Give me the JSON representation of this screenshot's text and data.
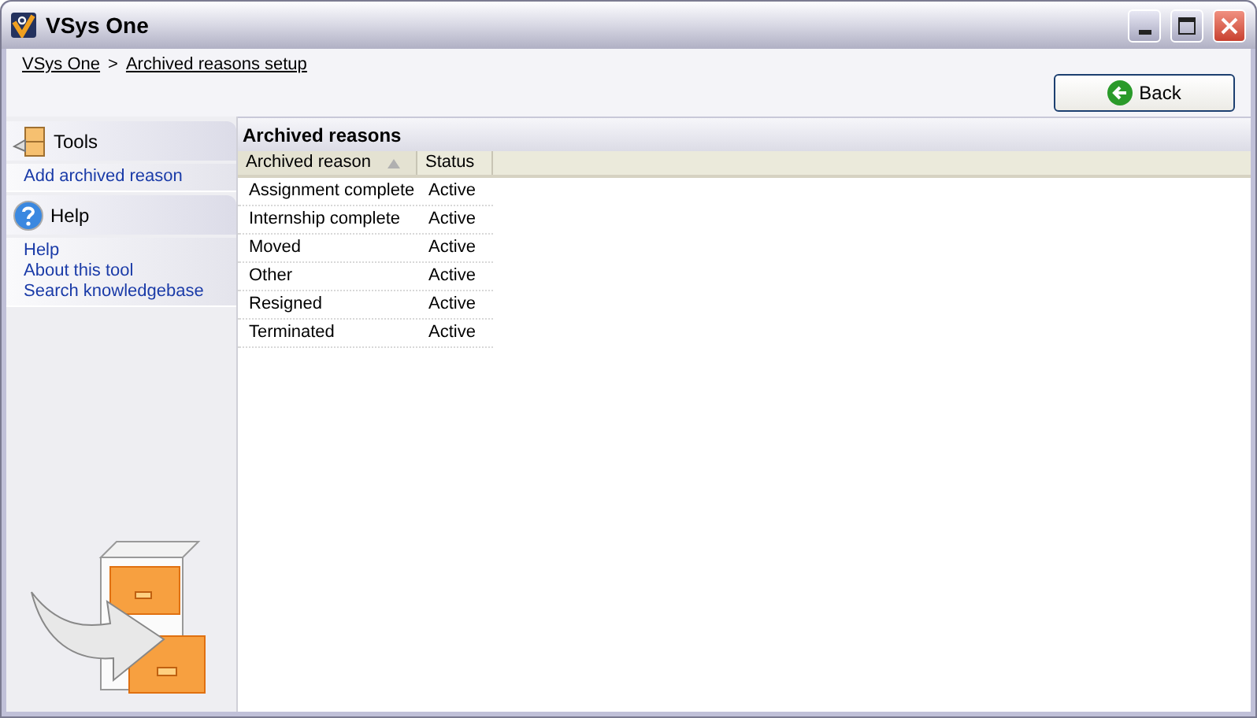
{
  "window": {
    "title": "VSys One"
  },
  "breadcrumb": [
    {
      "label": "VSys One"
    },
    {
      "label": "Archived reasons setup"
    }
  ],
  "breadcrumb_separator": ">",
  "back_button": {
    "label": "Back"
  },
  "sidebar": {
    "sections": [
      {
        "kind": "tools",
        "title": "Tools",
        "items": [
          "Add archived reason"
        ]
      },
      {
        "kind": "help",
        "title": "Help",
        "items": [
          "Help",
          "About this tool",
          "Search knowledgebase"
        ]
      }
    ]
  },
  "panel": {
    "title": "Archived reasons"
  },
  "table": {
    "columns": [
      {
        "label": "Archived reason",
        "sorted": true
      },
      {
        "label": "Status",
        "sorted": false
      }
    ],
    "rows": [
      [
        "Assignment complete",
        "Active"
      ],
      [
        "Internship complete",
        "Active"
      ],
      [
        "Moved",
        "Active"
      ],
      [
        "Other",
        "Active"
      ],
      [
        "Resigned",
        "Active"
      ],
      [
        "Terminated",
        "Active"
      ]
    ]
  }
}
